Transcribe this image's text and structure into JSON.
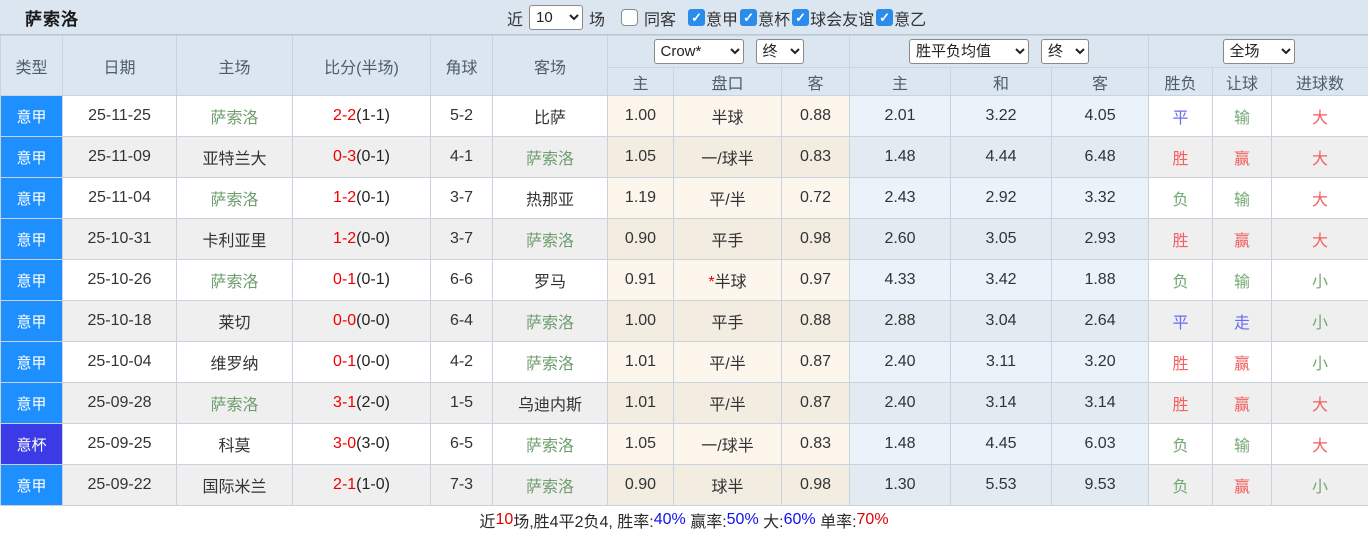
{
  "page": {
    "title": "萨索洛"
  },
  "topbar": {
    "near_label": "近",
    "count_value": "10",
    "field_label": "场",
    "filters": [
      {
        "label": "同客",
        "checked": false
      },
      {
        "label": "意甲",
        "checked": true
      },
      {
        "label": "意杯",
        "checked": true
      },
      {
        "label": "球会友谊",
        "checked": true
      },
      {
        "label": "意乙",
        "checked": true
      }
    ]
  },
  "table": {
    "headers": {
      "type": "类型",
      "date": "日期",
      "home": "主场",
      "score": "比分(半场)",
      "corners": "角球",
      "away": "客场"
    },
    "dropdowns": {
      "company": "Crow*",
      "company_stage": "终",
      "avg": "胜平负均值",
      "avg_stage": "终",
      "scope": "全场"
    },
    "subheaders": {
      "odds_home": "主",
      "handicap": "盘口",
      "odds_away": "客",
      "avg_home": "主",
      "avg_draw": "和",
      "avg_away": "客",
      "wdl": "胜负",
      "let_ball": "让球",
      "goals": "进球数"
    },
    "rows": [
      {
        "league": "意甲",
        "lt": "a",
        "date": "25-11-25",
        "home": "萨索洛",
        "home_self": true,
        "score": "2-2",
        "half": "(1-1)",
        "corners": "5-2",
        "away": "比萨",
        "away_self": false,
        "oh": "1.00",
        "star": "",
        "hcap": "半球",
        "oa": "0.88",
        "ah": "2.01",
        "ad": "3.22",
        "aa": "4.05",
        "wdl": "平",
        "wdl_c": "blue",
        "lb": "输",
        "lb_c": "green",
        "gl": "大",
        "gl_c": "red"
      },
      {
        "league": "意甲",
        "lt": "a",
        "date": "25-11-09",
        "home": "亚特兰大",
        "home_self": false,
        "score": "0-3",
        "half": "(0-1)",
        "corners": "4-1",
        "away": "萨索洛",
        "away_self": true,
        "oh": "1.05",
        "star": "",
        "hcap": "一/球半",
        "oa": "0.83",
        "ah": "1.48",
        "ad": "4.44",
        "aa": "6.48",
        "wdl": "胜",
        "wdl_c": "red",
        "lb": "赢",
        "lb_c": "red",
        "gl": "大",
        "gl_c": "red"
      },
      {
        "league": "意甲",
        "lt": "a",
        "date": "25-11-04",
        "home": "萨索洛",
        "home_self": true,
        "score": "1-2",
        "half": "(0-1)",
        "corners": "3-7",
        "away": "热那亚",
        "away_self": false,
        "oh": "1.19",
        "star": "",
        "hcap": "平/半",
        "oa": "0.72",
        "ah": "2.43",
        "ad": "2.92",
        "aa": "3.32",
        "wdl": "负",
        "wdl_c": "green",
        "lb": "输",
        "lb_c": "green",
        "gl": "大",
        "gl_c": "red"
      },
      {
        "league": "意甲",
        "lt": "a",
        "date": "25-10-31",
        "home": "卡利亚里",
        "home_self": false,
        "score": "1-2",
        "half": "(0-0)",
        "corners": "3-7",
        "away": "萨索洛",
        "away_self": true,
        "oh": "0.90",
        "star": "",
        "hcap": "平手",
        "oa": "0.98",
        "ah": "2.60",
        "ad": "3.05",
        "aa": "2.93",
        "wdl": "胜",
        "wdl_c": "red",
        "lb": "赢",
        "lb_c": "red",
        "gl": "大",
        "gl_c": "red"
      },
      {
        "league": "意甲",
        "lt": "a",
        "date": "25-10-26",
        "home": "萨索洛",
        "home_self": true,
        "score": "0-1",
        "half": "(0-1)",
        "corners": "6-6",
        "away": "罗马",
        "away_self": false,
        "oh": "0.91",
        "star": "*",
        "hcap": "半球",
        "oa": "0.97",
        "ah": "4.33",
        "ad": "3.42",
        "aa": "1.88",
        "wdl": "负",
        "wdl_c": "green",
        "lb": "输",
        "lb_c": "green",
        "gl": "小",
        "gl_c": "green"
      },
      {
        "league": "意甲",
        "lt": "a",
        "date": "25-10-18",
        "home": "莱切",
        "home_self": false,
        "score": "0-0",
        "half": "(0-0)",
        "corners": "6-4",
        "away": "萨索洛",
        "away_self": true,
        "oh": "1.00",
        "star": "",
        "hcap": "平手",
        "oa": "0.88",
        "ah": "2.88",
        "ad": "3.04",
        "aa": "2.64",
        "wdl": "平",
        "wdl_c": "blue",
        "lb": "走",
        "lb_c": "blue",
        "gl": "小",
        "gl_c": "green"
      },
      {
        "league": "意甲",
        "lt": "a",
        "date": "25-10-04",
        "home": "维罗纳",
        "home_self": false,
        "score": "0-1",
        "half": "(0-0)",
        "corners": "4-2",
        "away": "萨索洛",
        "away_self": true,
        "oh": "1.01",
        "star": "",
        "hcap": "平/半",
        "oa": "0.87",
        "ah": "2.40",
        "ad": "3.11",
        "aa": "3.20",
        "wdl": "胜",
        "wdl_c": "red",
        "lb": "赢",
        "lb_c": "red",
        "gl": "小",
        "gl_c": "green"
      },
      {
        "league": "意甲",
        "lt": "a",
        "date": "25-09-28",
        "home": "萨索洛",
        "home_self": true,
        "score": "3-1",
        "half": "(2-0)",
        "corners": "1-5",
        "away": "乌迪内斯",
        "away_self": false,
        "oh": "1.01",
        "star": "",
        "hcap": "平/半",
        "oa": "0.87",
        "ah": "2.40",
        "ad": "3.14",
        "aa": "3.14",
        "wdl": "胜",
        "wdl_c": "red",
        "lb": "赢",
        "lb_c": "red",
        "gl": "大",
        "gl_c": "red"
      },
      {
        "league": "意杯",
        "lt": "cup",
        "date": "25-09-25",
        "home": "科莫",
        "home_self": false,
        "score": "3-0",
        "half": "(3-0)",
        "corners": "6-5",
        "away": "萨索洛",
        "away_self": true,
        "oh": "1.05",
        "star": "",
        "hcap": "一/球半",
        "oa": "0.83",
        "ah": "1.48",
        "ad": "4.45",
        "aa": "6.03",
        "wdl": "负",
        "wdl_c": "green",
        "lb": "输",
        "lb_c": "green",
        "gl": "大",
        "gl_c": "red"
      },
      {
        "league": "意甲",
        "lt": "a",
        "date": "25-09-22",
        "home": "国际米兰",
        "home_self": false,
        "score": "2-1",
        "half": "(1-0)",
        "corners": "7-3",
        "away": "萨索洛",
        "away_self": true,
        "oh": "0.90",
        "star": "",
        "hcap": "球半",
        "oa": "0.98",
        "ah": "1.30",
        "ad": "5.53",
        "aa": "9.53",
        "wdl": "负",
        "wdl_c": "green",
        "lb": "赢",
        "lb_c": "red",
        "gl": "小",
        "gl_c": "green"
      }
    ]
  },
  "footer": {
    "segments": [
      {
        "text": "近",
        "color": "dark"
      },
      {
        "text": "10",
        "color": "red"
      },
      {
        "text": "场,胜4平2负4, 胜率:",
        "color": "dark"
      },
      {
        "text": "40%",
        "color": "blue"
      },
      {
        "text": " 赢率:",
        "color": "dark"
      },
      {
        "text": "50%",
        "color": "blue"
      },
      {
        "text": " 大:",
        "color": "dark"
      },
      {
        "text": "60%",
        "color": "blue"
      },
      {
        "text": " 单率:",
        "color": "dark"
      },
      {
        "text": "70%",
        "color": "red"
      }
    ]
  },
  "colors": {
    "serie_a_badge": "#1e8fff",
    "coppa_badge": "#3a3ae6",
    "self_team_green": "#6e9c6e",
    "score_red": "#f00000",
    "status_red": "#f26060",
    "status_green": "#74a874",
    "status_blue": "#6a6af5",
    "header_bg": "#dbe6f1",
    "odds_col_bg": "#fcf6ec",
    "avg_col_bg": "#e9f3f9"
  }
}
